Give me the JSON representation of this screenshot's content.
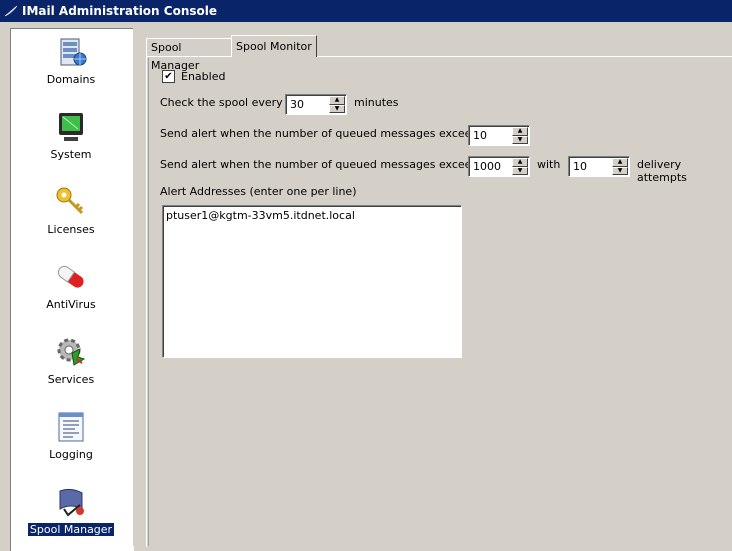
{
  "window": {
    "title": "IMail Administration Console"
  },
  "sidebar": {
    "items": [
      {
        "label": "Domains",
        "icon": "server-icon"
      },
      {
        "label": "System",
        "icon": "monitor-icon"
      },
      {
        "label": "Licenses",
        "icon": "key-icon"
      },
      {
        "label": "AntiVirus",
        "icon": "pill-icon"
      },
      {
        "label": "Services",
        "icon": "gear-icon"
      },
      {
        "label": "Logging",
        "icon": "document-icon"
      },
      {
        "label": "Spool Manager",
        "icon": "spool-icon",
        "active": true
      }
    ]
  },
  "tabs": [
    {
      "label": "Spool Manager"
    },
    {
      "label": "Spool Monitor",
      "active": true
    }
  ],
  "form": {
    "enabled_label": "Enabled",
    "enabled_checked": true,
    "check_mark": "✔",
    "check_prefix": "Check the spool every",
    "check_value": "30",
    "check_suffix": "minutes",
    "alert1_label": "Send alert when the number of queued messages exceeds",
    "alert1_value": "10",
    "alert2_label": "Send alert when the number of queued messages exceeds",
    "alert2_value": "1000",
    "with_label": "with",
    "attempts_value": "10",
    "attempts_suffix": "delivery attempts",
    "addresses_label": "Alert Addresses (enter one per line)",
    "addresses_value": "ptuser1@kgtm-33vm5.itdnet.local"
  },
  "colors": {
    "titlebar": "#0a246a",
    "face": "#d4d0c8",
    "selection": "#0a246a"
  }
}
